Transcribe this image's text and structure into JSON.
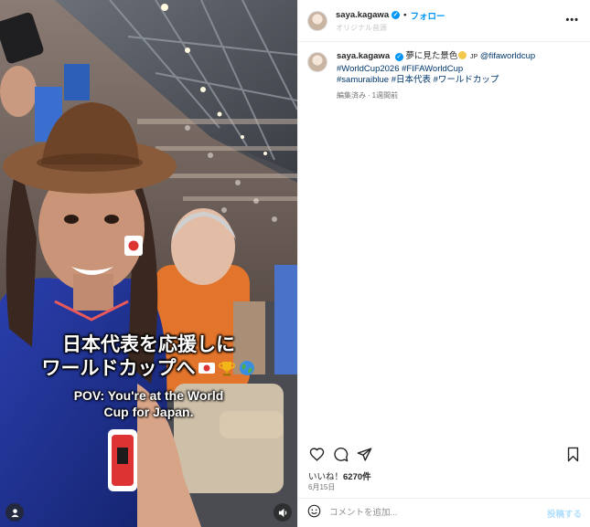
{
  "media": {
    "caption_jp_line1": "日本代表を応援しに",
    "caption_jp_line2": "ワールドカップへ",
    "caption_en_line1": "POV: You're at the World",
    "caption_en_line2": "Cup for Japan."
  },
  "header": {
    "username": "saya.kagawa",
    "separator": "•",
    "follow_label": "フォロー",
    "audio_text": "オリジナル音源"
  },
  "caption": {
    "username": "saya.kagawa",
    "text": "夢に見た景色",
    "suffix": "JP",
    "mention": "@fifaworldcup",
    "hashtag1": "#WorldCup2026",
    "hashtag2": "#FIFAWorldCup",
    "hashtag3": "#samuraiblue",
    "hashtag4": "#日本代表",
    "hashtag5": "#ワールドカップ",
    "edited_label": "編集済み",
    "meta_sep": "·",
    "time_ago": "1週間前"
  },
  "likes": {
    "prefix": "いいね！",
    "count": "6270件"
  },
  "date": "6月15日",
  "composer": {
    "placeholder": "コメントを追加...",
    "post_label": "投稿する"
  },
  "icons": [
    "user-tag-icon",
    "mute-icon",
    "verified-icon",
    "more-icon",
    "heart-icon",
    "comment-icon",
    "share-icon",
    "bookmark-icon",
    "emoji-icon"
  ],
  "colors": {
    "accent": "#0095f6",
    "link": "#00376b",
    "jersey": "#1b2d8f",
    "shirt_orange": "#e2742c"
  }
}
